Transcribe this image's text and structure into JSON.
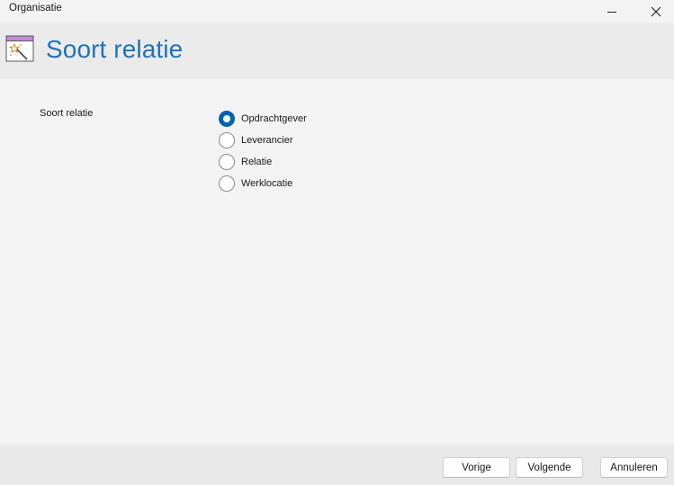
{
  "window": {
    "title": "Organisatie",
    "minimize_icon": "minimize-icon",
    "close_icon": "close-icon"
  },
  "header": {
    "icon": "wizard-icon",
    "title": "Soort relatie"
  },
  "form": {
    "label": "Soort relatie",
    "options": [
      {
        "label": "Opdrachtgever",
        "checked": true
      },
      {
        "label": "Leverancier",
        "checked": false
      },
      {
        "label": "Relatie",
        "checked": false
      },
      {
        "label": "Werklocatie",
        "checked": false
      }
    ]
  },
  "footer": {
    "previous_label": "Vorige",
    "next_label": "Volgende",
    "cancel_label": "Annuleren"
  },
  "colors": {
    "accent": "#0063b1",
    "heading": "#1e73be",
    "background": "#f3f3f3",
    "header_background": "#ebebeb",
    "footer_background": "#e9e9e9"
  }
}
